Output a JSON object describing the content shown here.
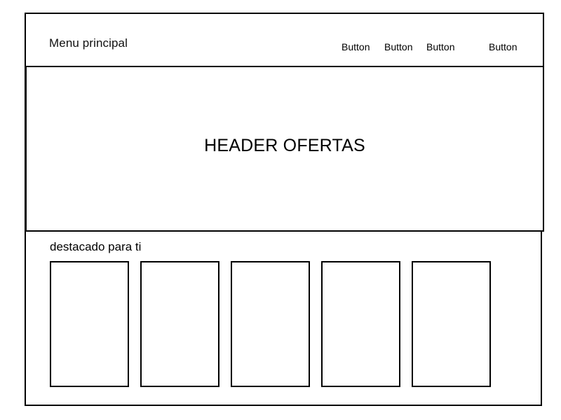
{
  "menu": {
    "title": "Menu principal",
    "buttons": [
      {
        "label": "Button"
      },
      {
        "label": "Button"
      },
      {
        "label": "Button"
      },
      {
        "label": "Button"
      }
    ]
  },
  "hero": {
    "title": "HEADER OFERTAS"
  },
  "featured": {
    "title": "destacado para ti",
    "card_count": 5
  }
}
